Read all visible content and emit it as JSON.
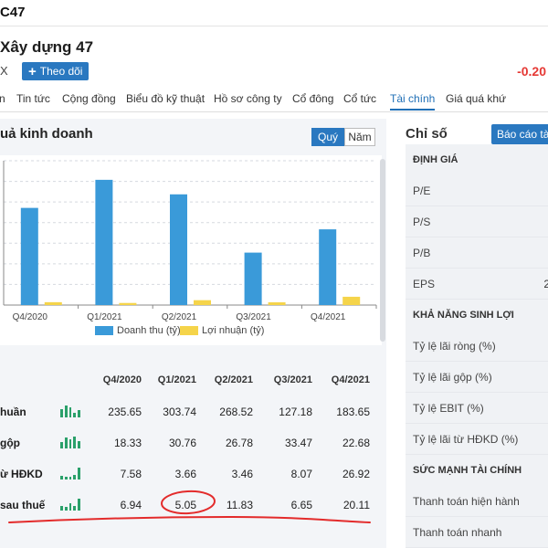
{
  "header": {
    "ticker": "C47",
    "company_name": "Xây dựng 47",
    "exchange_fragment": "X",
    "follow_label": "Theo dõi",
    "price_change": "-0.20"
  },
  "tabs": [
    {
      "label": "n"
    },
    {
      "label": "Tin tức"
    },
    {
      "label": "Cộng đồng"
    },
    {
      "label": "Biểu đồ kỹ thuật"
    },
    {
      "label": "Hồ sơ công ty"
    },
    {
      "label": "Cổ đông"
    },
    {
      "label": "Cổ tức"
    },
    {
      "label": "Tài chính"
    },
    {
      "label": "Giá quá khứ"
    }
  ],
  "left_panel": {
    "title": "uả kinh doanh",
    "toggle_quarter": "Quý",
    "toggle_year": "Năm"
  },
  "chart_data": {
    "type": "bar",
    "categories": [
      "Q4/2020",
      "Q1/2021",
      "Q2/2021",
      "Q3/2021",
      "Q4/2021"
    ],
    "series": [
      {
        "name": "Doanh thu (tỷ)",
        "color": "#3a9ad9",
        "values": [
          235.65,
          303.74,
          268.52,
          127.18,
          183.65
        ]
      },
      {
        "name": "Lợi nhuận (tỷ)",
        "color": "#f5d44a",
        "values": [
          6.94,
          5.05,
          11.83,
          6.65,
          20.11
        ]
      }
    ],
    "ylim": [
      0,
      350
    ],
    "grid": true,
    "legend": "bottom"
  },
  "table": {
    "headers": [
      "Q4/2020",
      "Q1/2021",
      "Q2/2021",
      "Q3/2021",
      "Q4/2021"
    ],
    "rows": [
      {
        "label": "huần",
        "values": [
          "235.65",
          "303.74",
          "268.52",
          "127.18",
          "183.65"
        ]
      },
      {
        "label": "gộp",
        "values": [
          "18.33",
          "30.76",
          "26.78",
          "33.47",
          "22.68"
        ]
      },
      {
        "label": "ừ HĐKD",
        "values": [
          "7.58",
          "3.66",
          "3.46",
          "8.07",
          "26.92"
        ]
      },
      {
        "label": "sau thuế",
        "values": [
          "6.94",
          "5.05",
          "11.83",
          "6.65",
          "20.11"
        ]
      }
    ]
  },
  "right_panel": {
    "title": "Chỉ số",
    "report_button": "Báo cáo tài",
    "sections": [
      {
        "heading": "ĐỊNH GIÁ",
        "items": [
          "P/E",
          "P/S",
          "P/B",
          "EPS"
        ]
      },
      {
        "heading": "KHẢ NĂNG SINH LỢI",
        "items": [
          "Tỷ lệ lãi ròng (%)",
          "Tỷ lệ lãi gộp (%)",
          "Tỷ lệ EBIT (%)",
          "Tỷ lệ lãi từ HĐKD (%)"
        ]
      },
      {
        "heading": "SỨC MẠNH TÀI CHÍNH",
        "items": [
          "Thanh toán hiện hành",
          "Thanh toán nhanh"
        ]
      }
    ],
    "eps_value_fragment": "2"
  },
  "colors": {
    "accent": "#2a78c0",
    "negative": "#e53935",
    "annotation": "#e32b2b"
  }
}
